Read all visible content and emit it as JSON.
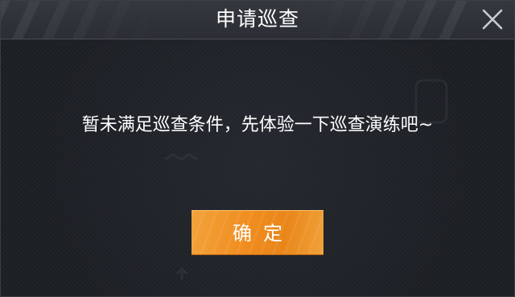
{
  "dialog": {
    "title": "申请巡查",
    "message": "暂未满足巡查条件，先体验一下巡查演练吧~",
    "confirm_label": "确定",
    "close_icon": "close-icon",
    "colors": {
      "background": "#1b1e23",
      "title_bar": "#2f3238",
      "button": "#f08c1e",
      "text": "#ffffff"
    }
  }
}
